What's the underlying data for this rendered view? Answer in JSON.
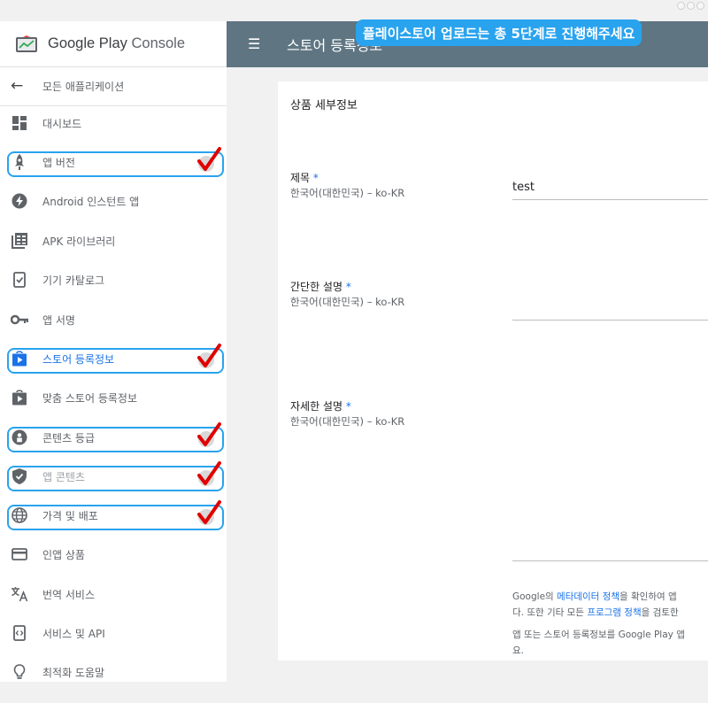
{
  "brand": {
    "logo_word1": "Google Play",
    "logo_word2": "Console",
    "logo_icon": "play-console-logo-icon"
  },
  "sidebar": {
    "back_label": "모든 애플리케이션",
    "items": [
      {
        "label": "대시보드",
        "icon": "dashboard-icon"
      },
      {
        "label": "앱 버전",
        "icon": "rocket-icon"
      },
      {
        "label": "Android 인스턴트 앱",
        "icon": "bolt-icon"
      },
      {
        "label": "APK 라이브러리",
        "icon": "library-icon"
      },
      {
        "label": "기기 카탈로그",
        "icon": "device-check-icon"
      },
      {
        "label": "앱 서명",
        "icon": "key-icon"
      },
      {
        "label": "스토어 등록정보",
        "icon": "store-icon"
      },
      {
        "label": "맞춤 스토어 등록정보",
        "icon": "store-icon"
      },
      {
        "label": "콘텐츠 등급",
        "icon": "rating-icon"
      },
      {
        "label": "앱 콘텐츠",
        "icon": "shield-icon"
      },
      {
        "label": "가격 및 배포",
        "icon": "globe-icon"
      },
      {
        "label": "인앱 상품",
        "icon": "card-icon"
      },
      {
        "label": "번역 서비스",
        "icon": "translate-icon"
      },
      {
        "label": "서비스 및 API",
        "icon": "api-icon"
      },
      {
        "label": "최적화 도움말",
        "icon": "lightbulb-icon"
      }
    ]
  },
  "topbar": {
    "title": "스토어 등록정보",
    "menu_icon": "hamburger-icon"
  },
  "callout": {
    "text": "플레이스토어 업로드는 총 5단계로 진행해주세요",
    "color": "#29a3ee"
  },
  "form": {
    "section_title": "상품 세부정보",
    "required_mark": "*",
    "locale": "한국어(대한민국) – ko-KR",
    "title_label": "제목",
    "title_value": "test",
    "short_desc_label": "간단한 설명",
    "full_desc_label": "자세한 설명"
  },
  "notice": {
    "l1_a": "Google의 ",
    "l1_link": "메타데이터 정책",
    "l1_b": "을 확인하여 앱",
    "l2_a": "다. 또한 기타 모든 ",
    "l2_link": "프로그램 정책",
    "l2_b": "을 검토한",
    "l3": "앱 또는 스토어 등록정보를 Google Play 앱",
    "l4": "요."
  },
  "colors": {
    "topbar": "#5f7582",
    "highlight": "#29a3ee",
    "check": "#e00000",
    "link": "#1a73e8"
  }
}
